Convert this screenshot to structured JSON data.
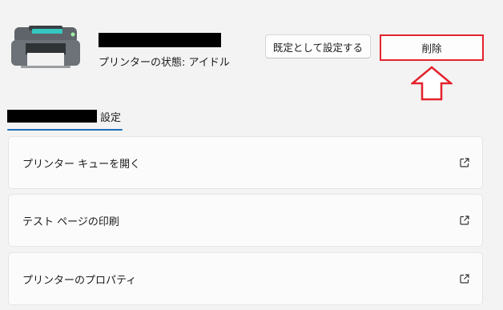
{
  "header": {
    "status_text": "プリンターの状態:  アイドル",
    "set_default_label": "既定として設定する",
    "delete_label": "削除"
  },
  "tab": {
    "label": "設定"
  },
  "cards": [
    {
      "label": "プリンター キューを開く",
      "icon": "open-external-icon"
    },
    {
      "label": "テスト ページの印刷",
      "icon": "open-external-icon"
    },
    {
      "label": "プリンターのプロパティ",
      "icon": "open-external-icon"
    }
  ],
  "colors": {
    "accent": "#1f6fb8",
    "highlight": "#e3222c"
  }
}
